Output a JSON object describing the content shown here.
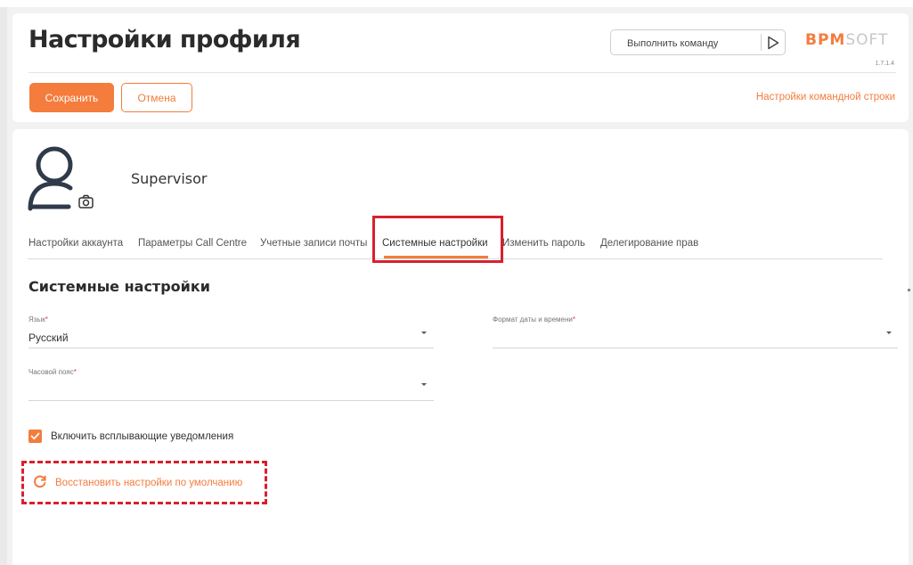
{
  "header": {
    "title": "Настройки профиля",
    "command_placeholder": "Выполнить команду",
    "logo_part1": "BPM",
    "logo_part2": "SOFT",
    "version": "1.7.1.4",
    "save_label": "Сохранить",
    "cancel_label": "Отмена",
    "cmdline_settings_link": "Настройки командной строки"
  },
  "profile": {
    "user_name": "Supervisor"
  },
  "tabs": [
    {
      "label": "Настройки аккаунта",
      "active": false
    },
    {
      "label": "Параметры Call Centre",
      "active": false
    },
    {
      "label": "Учетные записи почты",
      "active": false
    },
    {
      "label": "Системные настройки",
      "active": true
    },
    {
      "label": "Изменить пароль",
      "active": false
    },
    {
      "label": "Делегирование прав",
      "active": false
    }
  ],
  "system_settings": {
    "title": "Системные настройки",
    "language": {
      "label": "Язык",
      "value": "Русский"
    },
    "datetime_format": {
      "label": "Формат даты и времени",
      "value": ""
    },
    "timezone": {
      "label": "Часовой пояс",
      "value": ""
    },
    "required_mark": "*",
    "popup_notifications": {
      "label": "Включить всплывающие уведомления",
      "checked": true
    },
    "restore_defaults_label": "Восстановить настройки по умолчанию"
  },
  "colors": {
    "accent": "#f47c3c",
    "highlight": "#d8202f"
  }
}
